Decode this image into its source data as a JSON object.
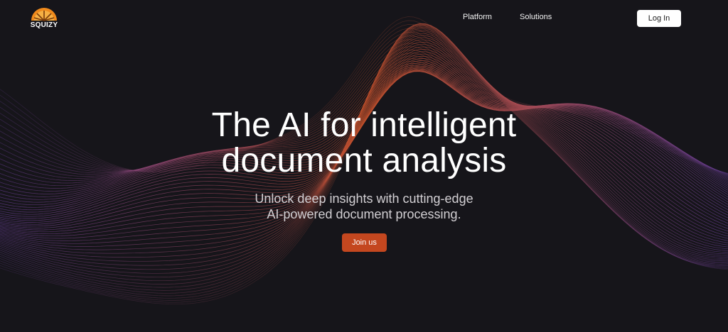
{
  "brand": {
    "name": "SQUIZY",
    "logo_icon": "orange-slice-icon",
    "logo_color": "#f08a1c"
  },
  "nav": {
    "items": [
      {
        "label": "Platform"
      },
      {
        "label": "Solutions"
      }
    ],
    "login_label": "Log In"
  },
  "hero": {
    "title_line1": "The AI for intelligent",
    "title_line2": "document analysis",
    "subtitle_line1": "Unlock deep insights with cutting-edge",
    "subtitle_line2": "AI-powered document processing.",
    "cta_label": "Join us"
  },
  "colors": {
    "background": "#16151a",
    "accent": "#c4471f",
    "wave_warm": "#c4502a",
    "wave_cool": "#6a3fa0"
  }
}
